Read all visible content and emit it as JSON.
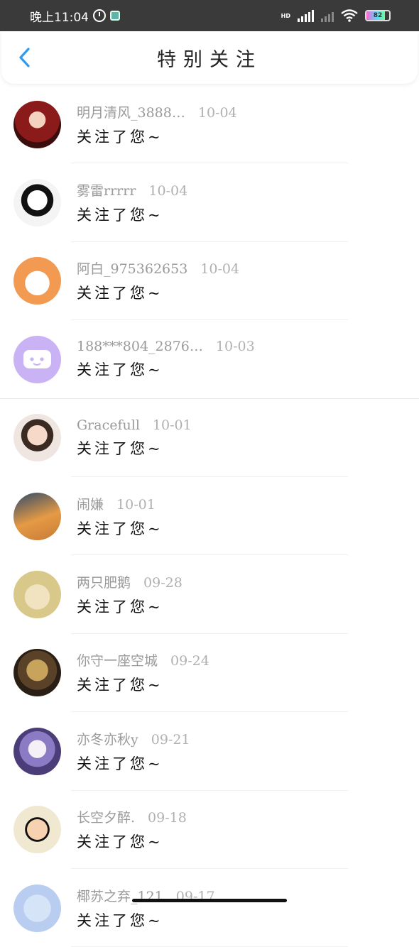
{
  "status_bar": {
    "time": "晚上11:04",
    "network_label": "HD",
    "battery": "82",
    "battery_level": 0.82
  },
  "header": {
    "title": "特别关注"
  },
  "colors": {
    "accent": "#2f9bf0",
    "meta_text": "#9a9a9a",
    "status_bar_bg": "#3a3a3a"
  },
  "follows": [
    {
      "name": "明月清风_3888…",
      "time": "10-04",
      "message": "关注了您~",
      "avatar": "girl-red-hat-avatar"
    },
    {
      "name": "雾雷rrrrr",
      "time": "10-04",
      "message": "关注了您~",
      "avatar": "manga-boy-avatar"
    },
    {
      "name": "阿白_975362653",
      "time": "10-04",
      "message": "关注了您~",
      "avatar": "cartoon-dog-avatar"
    },
    {
      "name": "188***804_2876…",
      "time": "10-03",
      "message": "关注了您~",
      "avatar": "default-chat-bubble-avatar"
    },
    {
      "name": "Gracefull",
      "time": "10-01",
      "message": "关注了您~",
      "avatar": "child-flower-crown-avatar"
    },
    {
      "name": "闹嫌",
      "time": "10-01",
      "message": "关注了您~",
      "avatar": "cat-avatar"
    },
    {
      "name": "两只肥鹅",
      "time": "09-28",
      "message": "关注了您~",
      "avatar": "anime-blonde-avatar"
    },
    {
      "name": "你守一座空城",
      "time": "09-24",
      "message": "关注了您~",
      "avatar": "golden-figure-avatar"
    },
    {
      "name": "亦冬亦秋y",
      "time": "09-21",
      "message": "关注了您~",
      "avatar": "anime-purple-hair-avatar"
    },
    {
      "name": "长空夕醉.",
      "time": "09-18",
      "message": "关注了您~",
      "avatar": "crayon-shin-chan-avatar"
    },
    {
      "name": "椰苏之弃_121",
      "time": "09-17",
      "message": "关注了您~",
      "avatar": "blue-avatar"
    }
  ]
}
